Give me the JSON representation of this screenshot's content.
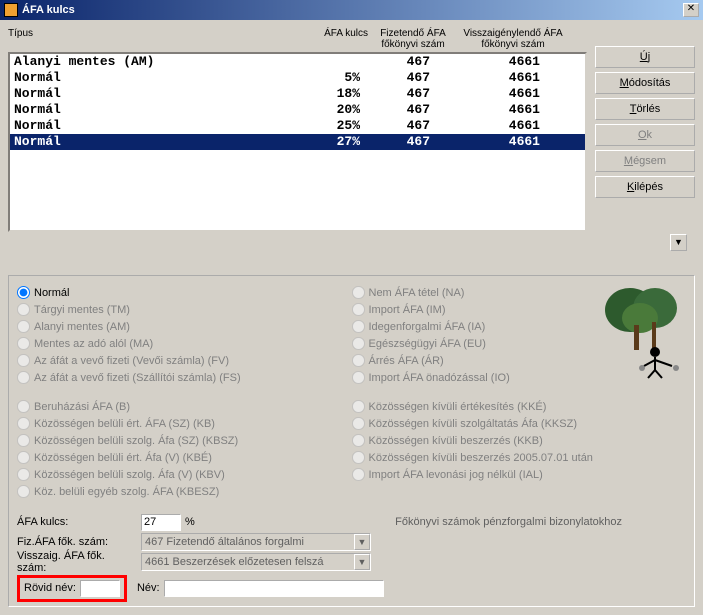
{
  "window": {
    "title": "ÁFA kulcs"
  },
  "columns": {
    "type": "Típus",
    "afa": "ÁFA kulcs",
    "fiz": "Fizetendő ÁFA főkönyvi szám",
    "vissza": "Visszaigénylendő ÁFA főkönyvi szám"
  },
  "rows": [
    {
      "type": "Alanyi mentes (AM)",
      "rate": "",
      "fiz": "467",
      "vissza": "4661",
      "sel": false
    },
    {
      "type": "Normál",
      "rate": "5%",
      "fiz": "467",
      "vissza": "4661",
      "sel": false
    },
    {
      "type": "Normál",
      "rate": "18%",
      "fiz": "467",
      "vissza": "4661",
      "sel": false
    },
    {
      "type": "Normál",
      "rate": "20%",
      "fiz": "467",
      "vissza": "4661",
      "sel": false
    },
    {
      "type": "Normál",
      "rate": "25%",
      "fiz": "467",
      "vissza": "4661",
      "sel": false
    },
    {
      "type": "Normál",
      "rate": "27%",
      "fiz": "467",
      "vissza": "4661",
      "sel": true
    }
  ],
  "buttons": {
    "new": "Új",
    "new_u": "Ú",
    "mod": "Módosítás",
    "mod_u": "M",
    "del": "Törlés",
    "del_u": "T",
    "ok": "Ok",
    "ok_u": "O",
    "cancel": "Mégsem",
    "cancel_u": "M",
    "exit": "Kilépés",
    "exit_u": "K"
  },
  "radios1_left": [
    "Normál",
    "Tárgyi mentes (TM)",
    "Alanyi mentes (AM)",
    "Mentes az adó alól (MA)",
    "Az áfát a vevő fizeti (Vevői számla) (FV)",
    "Az áfát a vevő fizeti (Szállítói számla) (FS)"
  ],
  "radios1_right": [
    "Nem ÁFA tétel (NA)",
    "Import ÁFA (IM)",
    "Idegenforgalmi ÁFA (IA)",
    "Egészségügyi ÁFA (EU)",
    "Árrés ÁFA (ÁR)",
    "Import ÁFA önadózással (IO)"
  ],
  "radios2_left": [
    "Beruházási ÁFA (B)",
    "Közösségen belüli ért. ÁFA (SZ) (KB)",
    "Közösségen belüli szolg. Áfa (SZ) (KBSZ)",
    "Közösségen belüli ért. Áfa (V) (KBÉ)",
    "Közösségen belüli szolg. Áfa (V) (KBV)",
    "Köz. belüli egyéb szolg. ÁFA (KBESZ)"
  ],
  "radios2_right": [
    "Közösségen kívüli értékesítés (KKÉ)",
    "Közösségen kívüli szolgáltatás Áfa (KKSZ)",
    "Közösségen kívüli beszerzés (KKB)",
    "Közösségen kívüli beszerzés 2005.07.01 után",
    "Import ÁFA levonási jog nélkül (IAL)"
  ],
  "form": {
    "afa_label": "ÁFA kulcs:",
    "afa_value": "27",
    "afa_pct": "%",
    "fiz_label": "Fiz.ÁFA fők. szám:",
    "fiz_value": "467    Fizetendő általános forgalmi",
    "vissza_label": "Visszaig. ÁFA fők. szám:",
    "vissza_value": "4661    Beszerzések előzetesen felszá",
    "heading_right": "Főkönyvi számok pénzforgalmi bizonylatokhoz",
    "rovid_label": "Rövid név:",
    "nev_label": "Név:"
  }
}
